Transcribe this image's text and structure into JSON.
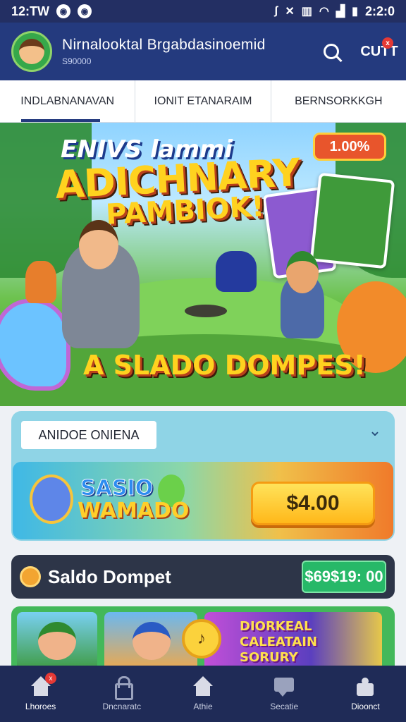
{
  "status_bar": {
    "time": "12:TW",
    "right_time": "2:2:0",
    "dot_icons": [
      "instagram-icon",
      "messenger-icon"
    ]
  },
  "header": {
    "title": "Nirnalooktal Brgabdasinoemid",
    "subtitle": "S90000",
    "notification_badge": "x",
    "profile_label": "CUTT"
  },
  "tabs": [
    {
      "label": "INDLABNANAVAN",
      "active": true
    },
    {
      "label": "IONIT ETANARAIM",
      "active": false
    },
    {
      "label": "BERNSORKKGH",
      "active": false
    }
  ],
  "hero": {
    "line1": "ENIVS lammi",
    "line2": "ADICHNARY",
    "line3": "PAMBIOK!",
    "bottom_text": "A SLADO DOMPES!",
    "badge": "1.00%"
  },
  "panel": {
    "select_value": "ANIDOE ONIENA",
    "promo_line1": "SASIO",
    "promo_line2": "WAMADO",
    "price": "$4.00"
  },
  "wallet": {
    "label": "Saldo Dompet",
    "badge": "$69$19: 00"
  },
  "games": {
    "tile3_text": "DIORKEAL CALEATAIN SORURY",
    "clock_glyph": "♪"
  },
  "bottom_nav": [
    {
      "label": "Lhoroes",
      "icon": "home-icon",
      "active": true,
      "badge": "x"
    },
    {
      "label": "Dncnaratc",
      "icon": "lock-icon",
      "active": false
    },
    {
      "label": "Athie",
      "icon": "home-outline-icon",
      "active": false
    },
    {
      "label": "Secatie",
      "icon": "chat-icon",
      "active": false
    },
    {
      "label": "Dioonct",
      "icon": "puzzle-icon",
      "active": true
    }
  ],
  "colors": {
    "header_bg": "#243a7e",
    "nav_bg": "#1f2b57",
    "accent_yellow": "#ffd21f",
    "wallet_green": "#27b868"
  }
}
